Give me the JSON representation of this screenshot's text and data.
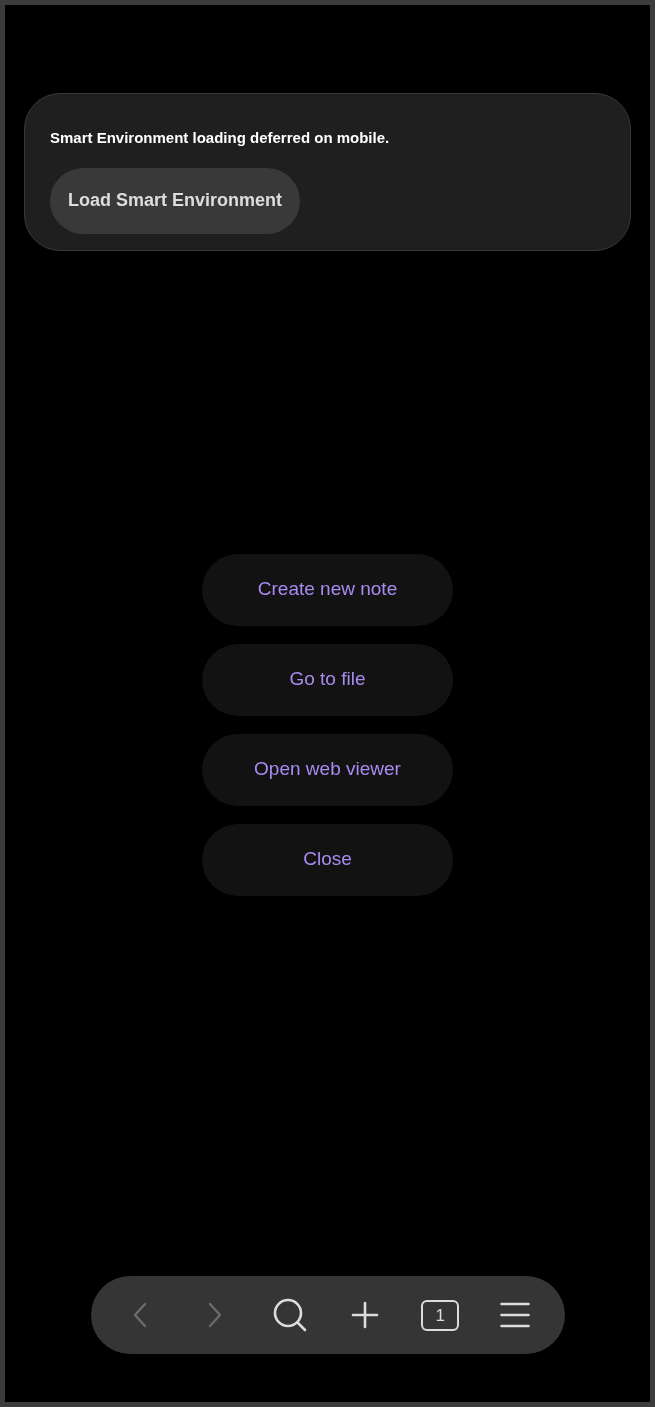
{
  "notice": {
    "message": "Smart Environment loading deferred on mobile.",
    "button": "Load Smart Environment"
  },
  "actions": [
    {
      "label": "Create new note"
    },
    {
      "label": "Go to file"
    },
    {
      "label": "Open web viewer"
    },
    {
      "label": "Close"
    }
  ],
  "toolbar": [
    {
      "kind": "back",
      "disabled": true
    },
    {
      "kind": "forward",
      "disabled": true
    },
    {
      "kind": "search",
      "disabled": false
    },
    {
      "kind": "new",
      "disabled": false
    },
    {
      "kind": "tabs",
      "disabled": false,
      "count": "1"
    },
    {
      "kind": "menu",
      "disabled": false
    }
  ]
}
